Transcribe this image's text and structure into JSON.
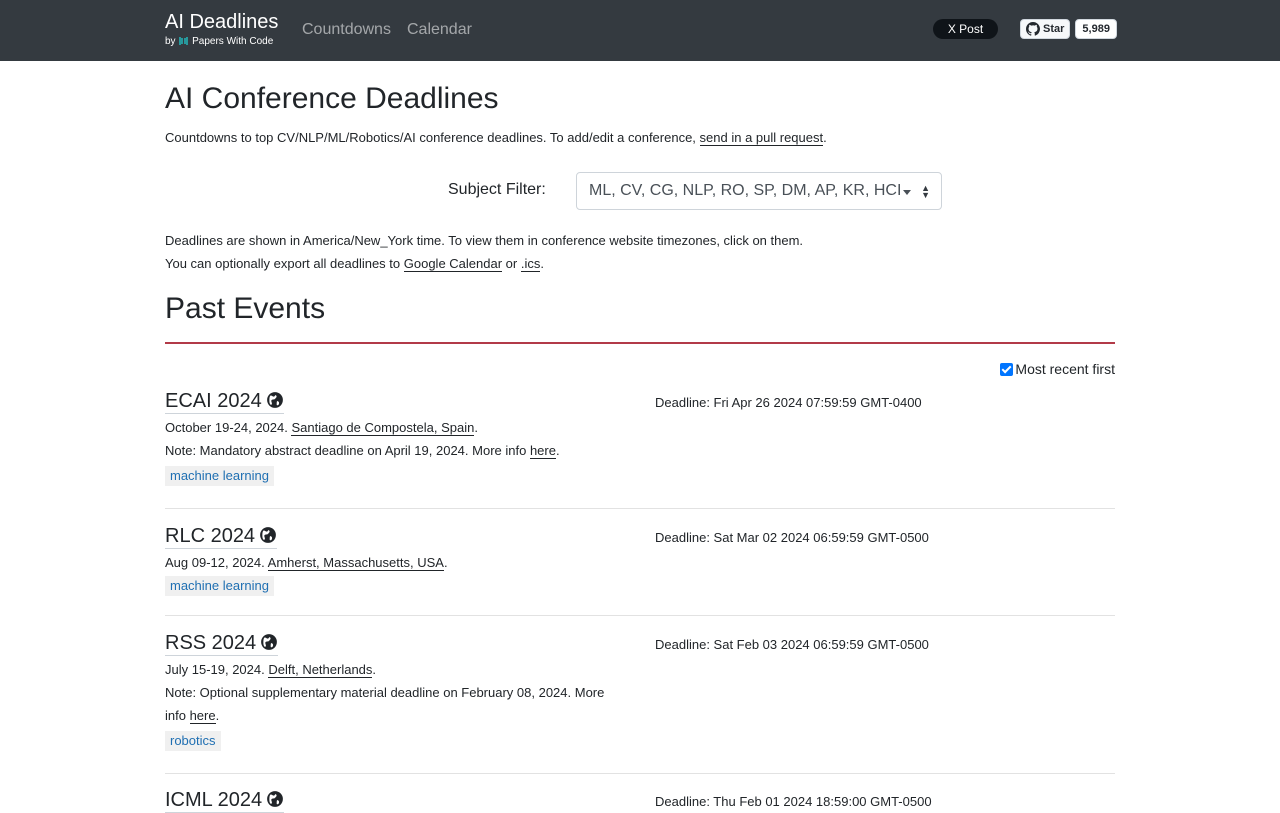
{
  "navbar": {
    "brand_title": "AI Deadlines",
    "brand_by": "by",
    "brand_sub": "Papers With Code",
    "links": [
      "Countdowns",
      "Calendar"
    ],
    "xpost_label": "X Post",
    "github_star_label": "Star",
    "github_star_count": "5,989"
  },
  "header": {
    "title": "AI Conference Deadlines",
    "intro_text": "Countdowns to top CV/NLP/ML/Robotics/AI conference deadlines. To add/edit a conference, ",
    "intro_link": "send in a pull request",
    "intro_end": "."
  },
  "filter": {
    "label": "Subject Filter:",
    "selected": "ML, CV, CG, NLP, RO, SP, DM, AP, KR, HCI"
  },
  "tz_note": {
    "line1": "Deadlines are shown in America/New_York time. To view them in conference website timezones, click on them.",
    "line2_prefix": "You can optionally export all deadlines to ",
    "google_calendar": "Google Calendar",
    "or": " or ",
    "ics": ".ics",
    "end": "."
  },
  "past_events": {
    "title": "Past Events",
    "sort_label": "Most recent first",
    "sort_checked": true
  },
  "conferences": [
    {
      "name": "ECAI 2024",
      "dates": "October 19-24, 2024. ",
      "location": "Santiago de Compostela, Spain",
      "note_prefix": "Note: Mandatory abstract deadline on April 19, 2024. More info ",
      "note_link": "here",
      "deadline": "Deadline: Fri Apr 26 2024 07:59:59 GMT-0400",
      "tag": "machine learning"
    },
    {
      "name": "RLC 2024",
      "dates": "Aug 09-12, 2024. ",
      "location": "Amherst, Massachusetts, USA",
      "deadline": "Deadline: Sat Mar 02 2024 06:59:59 GMT-0500",
      "tag": "machine learning"
    },
    {
      "name": "RSS 2024",
      "dates": "July 15-19, 2024. ",
      "location": "Delft, Netherlands",
      "note_prefix": "Note: Optional supplementary material deadline on February 08, 2024. More info ",
      "note_link": "here",
      "deadline": "Deadline: Sat Feb 03 2024 06:59:59 GMT-0500",
      "tag": "robotics"
    },
    {
      "name": "ICML 2024",
      "deadline": "Deadline: Thu Feb 01 2024 18:59:00 GMT-0500"
    }
  ],
  "colors": {
    "navbar_bg": "#343a40",
    "section_rule": "#b23a48",
    "tag_text": "#1f6fb2",
    "tag_bg": "#f0f0f0"
  }
}
